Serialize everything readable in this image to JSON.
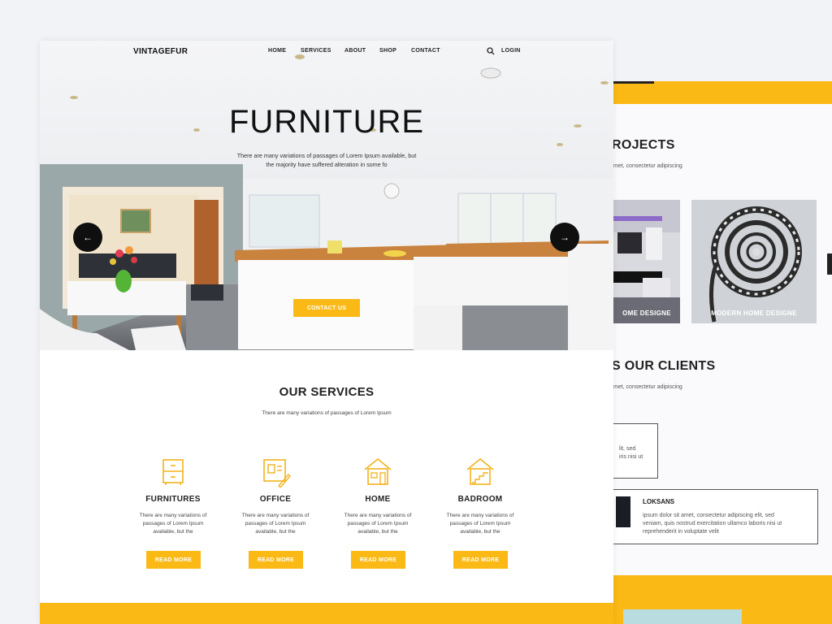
{
  "brand": {
    "logo": "VINTAGEFUR",
    "accent": "#fbb916"
  },
  "nav": {
    "items": [
      "HOME",
      "SERVICES",
      "ABOUT",
      "SHOP",
      "CONTACT"
    ],
    "login": "LOGIN",
    "search_icon": "search-icon"
  },
  "hero": {
    "title": "FURNITURE",
    "subtitle_line1": "There are many variations of passages of Lorem Ipsum available, but",
    "subtitle_line2": "the majority have suffered alteration in some fo",
    "cta": "CONTACT US",
    "prev_icon": "arrow-left-icon",
    "next_icon": "arrow-right-icon"
  },
  "services": {
    "title": "OUR SERVICES",
    "subtitle": "There are many variations of passages of Lorem Ipsum",
    "items": [
      {
        "title": "FURNITURES",
        "line1": "There are many variations of",
        "line2": "passages of Lorem Ipsum",
        "line3": "available, but the",
        "button": "READ MORE",
        "icon": "cabinet-icon"
      },
      {
        "title": "OFFICE",
        "line1": "There are many variations of",
        "line2": "passages of Lorem Ipsum",
        "line3": "available, but the",
        "button": "READ MORE",
        "icon": "office-icon"
      },
      {
        "title": "HOME",
        "line1": "There are many variations of",
        "line2": "passages of Lorem Ipsum",
        "line3": "available, but the",
        "button": "READ MORE",
        "icon": "house-icon"
      },
      {
        "title": "BADROOM",
        "line1": "There are many variations of",
        "line2": "passages of Lorem Ipsum",
        "line3": "available, but the",
        "button": "READ MORE",
        "icon": "stairs-icon"
      }
    ]
  },
  "back": {
    "projects_title": "ROJECTS",
    "projects_sub": "met, consectetur adipiscing",
    "tiles": [
      "OME DESIGNE",
      "MODERN HOME DESIGNE"
    ],
    "clients_title": "S OUR CLIENTS",
    "clients_sub": "met, consectetur adipiscing",
    "card1_line1": "lit, sed",
    "card1_line2": "iris nisi ut",
    "card2_name": "LOKSANS",
    "card2_line1": "ipsum dolor sit amet, consectetur adipiscing elit, sed",
    "card2_line2": "veniam, quis nostrud exercitation ullamco laboris nisi ut",
    "card2_line3": "reprehenderit in voluptate velit"
  }
}
